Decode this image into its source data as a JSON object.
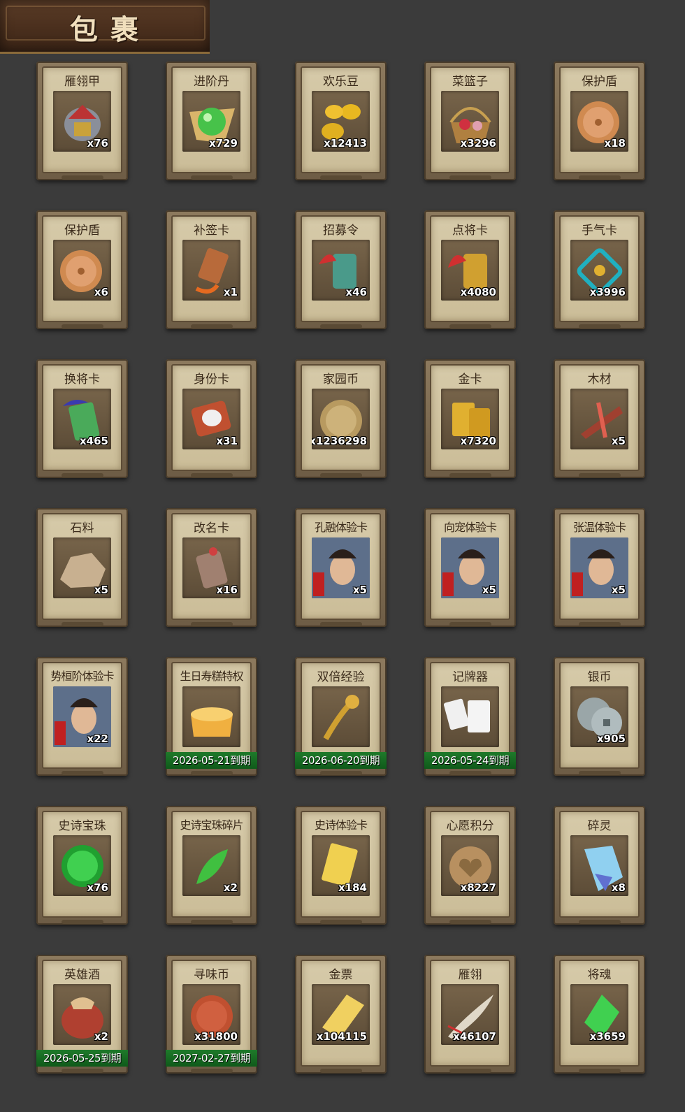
{
  "panel": {
    "title": "包裹"
  },
  "items": [
    {
      "name": "雁翎甲",
      "qty": "x76",
      "icon": "armor-icon",
      "expire": null
    },
    {
      "name": "进阶丹",
      "qty": "x729",
      "icon": "advance-pill-icon",
      "expire": null
    },
    {
      "name": "欢乐豆",
      "qty": "x12413",
      "icon": "happy-bean-icon",
      "expire": null
    },
    {
      "name": "菜篮子",
      "qty": "x3296",
      "icon": "vegetable-basket-icon",
      "expire": null
    },
    {
      "name": "保护盾",
      "qty": "x18",
      "icon": "shield-icon",
      "expire": null
    },
    {
      "name": "保护盾",
      "qty": "x6",
      "icon": "shield-icon",
      "expire": null
    },
    {
      "name": "补签卡",
      "qty": "x1",
      "icon": "resign-card-icon",
      "expire": null
    },
    {
      "name": "招募令",
      "qty": "x46",
      "icon": "recruit-token-icon",
      "expire": null
    },
    {
      "name": "点将卡",
      "qty": "x4080",
      "icon": "general-pick-card-icon",
      "expire": null
    },
    {
      "name": "手气卡",
      "qty": "x3996",
      "icon": "luck-card-icon",
      "expire": null
    },
    {
      "name": "换将卡",
      "qty": "x465",
      "icon": "swap-general-card-icon",
      "expire": null
    },
    {
      "name": "身份卡",
      "qty": "x31",
      "icon": "identity-card-icon",
      "expire": null
    },
    {
      "name": "家园币",
      "qty": "x1236298",
      "icon": "home-coin-icon",
      "expire": null
    },
    {
      "name": "金卡",
      "qty": "x7320",
      "icon": "gold-card-icon",
      "expire": null
    },
    {
      "name": "木材",
      "qty": "x5",
      "icon": "wood-icon",
      "expire": null
    },
    {
      "name": "石料",
      "qty": "x5",
      "icon": "stone-icon",
      "expire": null
    },
    {
      "name": "改名卡",
      "qty": "x16",
      "icon": "rename-card-icon",
      "expire": null
    },
    {
      "name": "孔融体验卡",
      "qty": "x5",
      "icon": "trial-portrait-icon",
      "expire": null
    },
    {
      "name": "向宠体验卡",
      "qty": "x5",
      "icon": "trial-portrait-icon",
      "expire": null
    },
    {
      "name": "张温体验卡",
      "qty": "x5",
      "icon": "trial-portrait-icon",
      "expire": null
    },
    {
      "name": "势桓阶体验卡",
      "qty": "x22",
      "icon": "trial-portrait-icon",
      "expire": null
    },
    {
      "name": "生日寿糕特权",
      "qty": "",
      "icon": "birthday-cake-icon",
      "expire": "2026-05-21到期"
    },
    {
      "name": "双倍经验",
      "qty": "",
      "icon": "double-exp-icon",
      "expire": "2026-06-20到期"
    },
    {
      "name": "记牌器",
      "qty": "",
      "icon": "card-counter-icon",
      "expire": "2026-05-24到期"
    },
    {
      "name": "银币",
      "qty": "x905",
      "icon": "silver-coin-icon",
      "expire": null
    },
    {
      "name": "史诗宝珠",
      "qty": "x76",
      "icon": "epic-orb-icon",
      "expire": null
    },
    {
      "name": "史诗宝珠碎片",
      "qty": "x2",
      "icon": "orb-fragment-icon",
      "expire": null
    },
    {
      "name": "史诗体验卡",
      "qty": "x184",
      "icon": "epic-trial-card-icon",
      "expire": null
    },
    {
      "name": "心愿积分",
      "qty": "x8227",
      "icon": "wish-points-icon",
      "expire": null
    },
    {
      "name": "碎灵",
      "qty": "x8",
      "icon": "crystal-shard-icon",
      "expire": null
    },
    {
      "name": "英雄酒",
      "qty": "x2",
      "icon": "hero-wine-icon",
      "expire": "2026-05-25到期"
    },
    {
      "name": "寻味币",
      "qty": "x31800",
      "icon": "flavor-coin-icon",
      "expire": "2027-02-27到期"
    },
    {
      "name": "金票",
      "qty": "x104115",
      "icon": "gold-ticket-icon",
      "expire": null
    },
    {
      "name": "雁翎",
      "qty": "x46107",
      "icon": "feather-icon",
      "expire": null
    },
    {
      "name": "将魂",
      "qty": "x3659",
      "icon": "general-soul-icon",
      "expire": null
    }
  ],
  "colors": {
    "background": "#3b3b3b",
    "card": "#cbbd98",
    "expire_band": "#1f7a2a"
  }
}
